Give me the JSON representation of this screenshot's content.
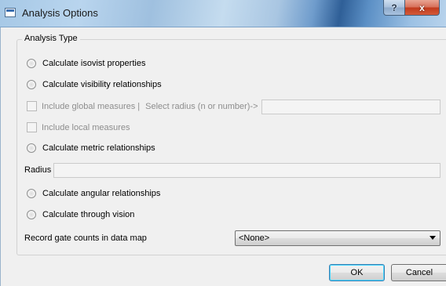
{
  "window": {
    "title": "Analysis Options",
    "help_glyph": "?",
    "close_glyph": "x"
  },
  "analysis_type": {
    "group_title": "Analysis Type",
    "isovist_label": "Calculate isovist properties",
    "visibility_label": "Calculate visibility relationships",
    "global_measures_label": "Include global measures |",
    "select_radius_label": "Select radius (n or number)->",
    "select_radius_value": "",
    "local_measures_label": "Include local measures",
    "metric_label": "Calculate metric relationships",
    "radius_label": "Radius",
    "radius_value": "",
    "angular_label": "Calculate angular relationships",
    "through_vision_label": "Calculate through vision",
    "gate_counts_label": "Record gate counts in data map",
    "gate_counts_selected": "<None>"
  },
  "buttons": {
    "ok_label": "OK",
    "cancel_label": "Cancel"
  },
  "colors": {
    "window_bg": "#f0f0f0",
    "close_button": "#c13a1c",
    "disabled_text": "#8d8d8d"
  }
}
